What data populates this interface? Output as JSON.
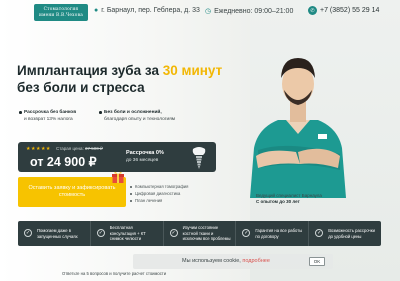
{
  "header": {
    "logo_line1": "Стоматология",
    "logo_line2": "имени В.В.Чехова",
    "address": "г. Барнаул, пер. Геблера, д. 33",
    "hours": "Ежедневно: 09:00–21:00",
    "phone": "+7 (3852) 55 29 14"
  },
  "hero": {
    "title_part1": "Имплантация зуба за ",
    "title_highlight": "30 минут",
    "title_part2": "без боли и стресса",
    "bullets": [
      {
        "title": "Рассрочка без банков",
        "text": "и возврат 13% налога"
      },
      {
        "title": "Без боли и осложнений,",
        "text": "благодаря опыту и технологиям"
      }
    ]
  },
  "price": {
    "stars": "★★★★★",
    "old_label": "Старая цена:",
    "old_value": "37 500 ₽",
    "new_price": "от 24 900 ₽",
    "installment_line1": "Рассрочка 0%",
    "installment_line2": "до 36 месяцев"
  },
  "cta": {
    "label": "Оставить заявку и зафиксировать стоимость"
  },
  "features": [
    "Компьютерная томография",
    "Цифровая диагностика",
    "План лечения"
  ],
  "doctor": {
    "caption1": "Ведущий специалист Барнаула",
    "caption2": "С опытом до 30 лет"
  },
  "benefits": [
    "Помогаем даже в запущенных случаях",
    "Бесплатная консультация + КТ снимок челюсти",
    "Изучим состояние костной ткани и исключим все проблемы",
    "Гарантия на все работы по договору",
    "Возможность рассрочки до удобной цены"
  ],
  "quiz": "Ответьте на 5 вопросов и получите расчет стоимости",
  "cookie": {
    "text": "Мы используем cookie, ",
    "link": "подробнее",
    "ok": "OK"
  },
  "colors": {
    "accent": "#1f8a84",
    "highlight": "#f2b705",
    "dark": "#2f3d3f",
    "cta": "#f7c300"
  }
}
